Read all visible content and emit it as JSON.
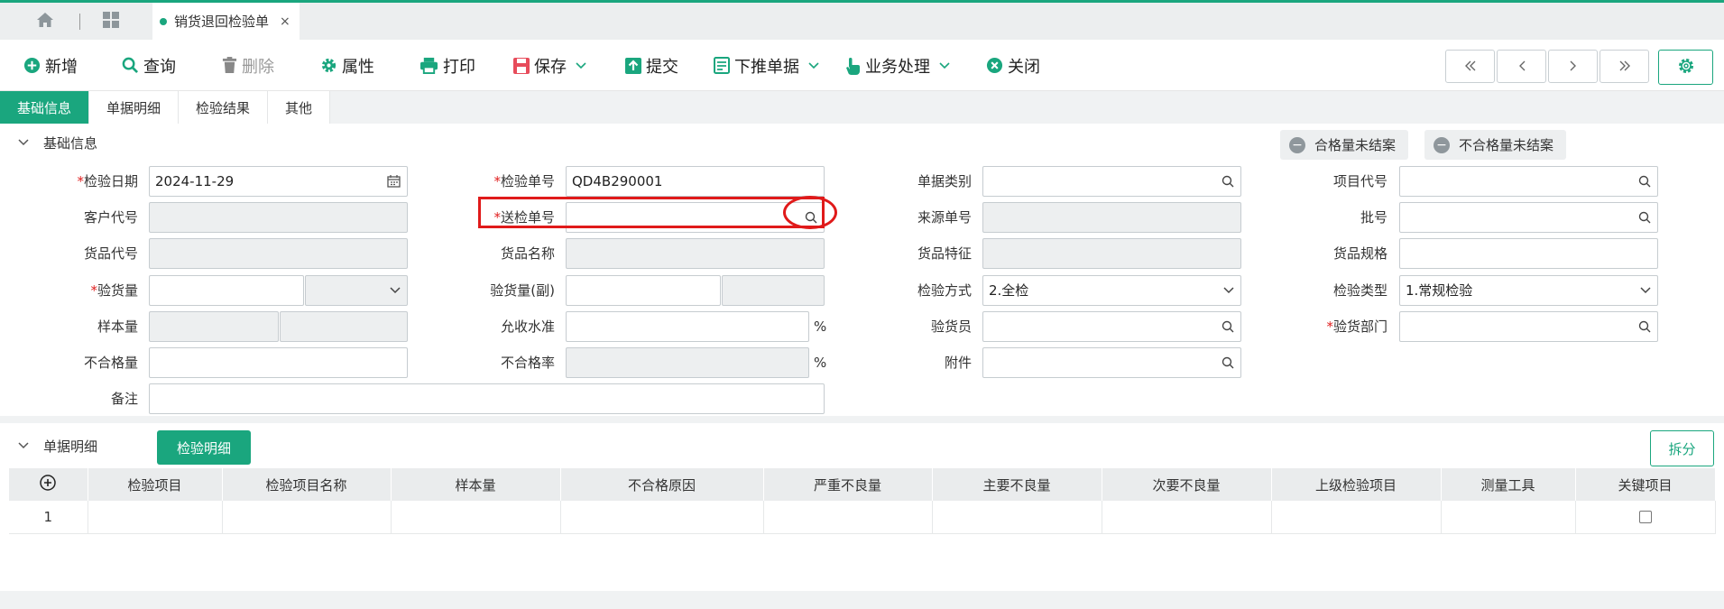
{
  "tabbar": {
    "active_tab": "销货退回检验单",
    "close_glyph": "×"
  },
  "toolbar": {
    "new": "新增",
    "query": "查询",
    "delete": "删除",
    "properties": "属性",
    "print": "打印",
    "save": "保存",
    "submit": "提交",
    "push_down": "下推单据",
    "business": "业务处理",
    "close": "关闭"
  },
  "subtabs": [
    "基础信息",
    "单据明细",
    "检验结果",
    "其他"
  ],
  "basic": {
    "title": "基础信息",
    "chip_qualified": "合格量未结案",
    "chip_unqualified": "不合格量未结案",
    "fields": {
      "inspect_date": {
        "label": "检验日期",
        "value": "2024-11-29"
      },
      "customer_code": {
        "label": "客户代号"
      },
      "goods_code": {
        "label": "货品代号"
      },
      "inspect_qty": {
        "label": "验货量"
      },
      "sample_qty": {
        "label": "样本量"
      },
      "unqualified_qty": {
        "label": "不合格量"
      },
      "remark": {
        "label": "备注"
      },
      "inspect_no": {
        "label": "检验单号",
        "value": "QD4B290001"
      },
      "send_no": {
        "label": "送检单号"
      },
      "goods_name": {
        "label": "货品名称"
      },
      "inspect_qty_sub": {
        "label": "验货量(副)"
      },
      "accept_level": {
        "label": "允收水准",
        "unit": "%"
      },
      "unqualified_rate": {
        "label": "不合格率",
        "unit": "%"
      },
      "doc_type": {
        "label": "单据类别"
      },
      "source_no": {
        "label": "来源单号"
      },
      "goods_feature": {
        "label": "货品特征"
      },
      "inspect_method": {
        "label": "检验方式",
        "value": "2.全检"
      },
      "inspector": {
        "label": "验货员"
      },
      "attachment": {
        "label": "附件"
      },
      "project_code": {
        "label": "项目代号"
      },
      "batch_no": {
        "label": "批号"
      },
      "goods_spec": {
        "label": "货品规格"
      },
      "inspect_type": {
        "label": "检验类型",
        "value": "1.常规检验"
      },
      "inspect_dept": {
        "label": "验货部门"
      }
    }
  },
  "detail": {
    "title": "单据明细",
    "tab_button": "检验明细",
    "split_button": "拆分",
    "columns": [
      "检验项目",
      "检验项目名称",
      "样本量",
      "不合格原因",
      "严重不良量",
      "主要不良量",
      "次要不良量",
      "上级检验项目",
      "测量工具",
      "关键项目"
    ],
    "rows": [
      {
        "no": "1"
      }
    ]
  },
  "colors": {
    "accent": "#1aa67e",
    "required": "#e02020",
    "highlight": "#e01a1a"
  }
}
